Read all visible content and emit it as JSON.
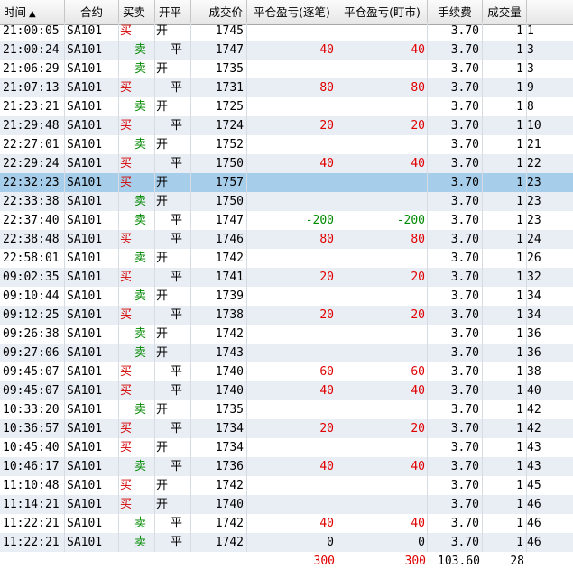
{
  "columns": {
    "time": "时间",
    "sort_glyph": "▲",
    "contract": "合约",
    "side": "买卖",
    "open_close": "开平",
    "price": "成交价",
    "pnl_trade": "平仓盈亏(逐笔)",
    "pnl_mark": "平仓盈亏(盯市)",
    "fee": "手续费",
    "volume": "成交量"
  },
  "labels": {
    "buy": "买",
    "sell": "卖",
    "open": "开",
    "close": "平"
  },
  "selected_row": 8,
  "rows": [
    {
      "time": "21:00:05",
      "contract": "SA101",
      "side": "buy",
      "oc": "open",
      "price": "1745",
      "pnl1": "",
      "pnl2": "",
      "fee": "3.70",
      "vol": "1",
      "extra": "1"
    },
    {
      "time": "21:00:24",
      "contract": "SA101",
      "side": "sell",
      "oc": "close",
      "price": "1747",
      "pnl1": "40",
      "pnl2": "40",
      "fee": "3.70",
      "vol": "1",
      "extra": "3"
    },
    {
      "time": "21:06:29",
      "contract": "SA101",
      "side": "sell",
      "oc": "open",
      "price": "1735",
      "pnl1": "",
      "pnl2": "",
      "fee": "3.70",
      "vol": "1",
      "extra": "3"
    },
    {
      "time": "21:07:13",
      "contract": "SA101",
      "side": "buy",
      "oc": "close",
      "price": "1731",
      "pnl1": "80",
      "pnl2": "80",
      "fee": "3.70",
      "vol": "1",
      "extra": "9"
    },
    {
      "time": "21:23:21",
      "contract": "SA101",
      "side": "sell",
      "oc": "open",
      "price": "1725",
      "pnl1": "",
      "pnl2": "",
      "fee": "3.70",
      "vol": "1",
      "extra": "8"
    },
    {
      "time": "21:29:48",
      "contract": "SA101",
      "side": "buy",
      "oc": "close",
      "price": "1724",
      "pnl1": "20",
      "pnl2": "20",
      "fee": "3.70",
      "vol": "1",
      "extra": "10"
    },
    {
      "time": "22:27:01",
      "contract": "SA101",
      "side": "sell",
      "oc": "open",
      "price": "1752",
      "pnl1": "",
      "pnl2": "",
      "fee": "3.70",
      "vol": "1",
      "extra": "21"
    },
    {
      "time": "22:29:24",
      "contract": "SA101",
      "side": "buy",
      "oc": "close",
      "price": "1750",
      "pnl1": "40",
      "pnl2": "40",
      "fee": "3.70",
      "vol": "1",
      "extra": "22"
    },
    {
      "time": "22:32:23",
      "contract": "SA101",
      "side": "buy",
      "oc": "open",
      "price": "1757",
      "pnl1": "",
      "pnl2": "",
      "fee": "3.70",
      "vol": "1",
      "extra": "23"
    },
    {
      "time": "22:33:38",
      "contract": "SA101",
      "side": "sell",
      "oc": "open",
      "price": "1750",
      "pnl1": "",
      "pnl2": "",
      "fee": "3.70",
      "vol": "1",
      "extra": "23"
    },
    {
      "time": "22:37:40",
      "contract": "SA101",
      "side": "sell",
      "oc": "close",
      "price": "1747",
      "pnl1": "-200",
      "pnl2": "-200",
      "fee": "3.70",
      "vol": "1",
      "extra": "23"
    },
    {
      "time": "22:38:48",
      "contract": "SA101",
      "side": "buy",
      "oc": "close",
      "price": "1746",
      "pnl1": "80",
      "pnl2": "80",
      "fee": "3.70",
      "vol": "1",
      "extra": "24"
    },
    {
      "time": "22:58:01",
      "contract": "SA101",
      "side": "sell",
      "oc": "open",
      "price": "1742",
      "pnl1": "",
      "pnl2": "",
      "fee": "3.70",
      "vol": "1",
      "extra": "26"
    },
    {
      "time": "09:02:35",
      "contract": "SA101",
      "side": "buy",
      "oc": "close",
      "price": "1741",
      "pnl1": "20",
      "pnl2": "20",
      "fee": "3.70",
      "vol": "1",
      "extra": "32"
    },
    {
      "time": "09:10:44",
      "contract": "SA101",
      "side": "sell",
      "oc": "open",
      "price": "1739",
      "pnl1": "",
      "pnl2": "",
      "fee": "3.70",
      "vol": "1",
      "extra": "34"
    },
    {
      "time": "09:12:25",
      "contract": "SA101",
      "side": "buy",
      "oc": "close",
      "price": "1738",
      "pnl1": "20",
      "pnl2": "20",
      "fee": "3.70",
      "vol": "1",
      "extra": "34"
    },
    {
      "time": "09:26:38",
      "contract": "SA101",
      "side": "sell",
      "oc": "open",
      "price": "1742",
      "pnl1": "",
      "pnl2": "",
      "fee": "3.70",
      "vol": "1",
      "extra": "36"
    },
    {
      "time": "09:27:06",
      "contract": "SA101",
      "side": "sell",
      "oc": "open",
      "price": "1743",
      "pnl1": "",
      "pnl2": "",
      "fee": "3.70",
      "vol": "1",
      "extra": "36"
    },
    {
      "time": "09:45:07",
      "contract": "SA101",
      "side": "buy",
      "oc": "close",
      "price": "1740",
      "pnl1": "60",
      "pnl2": "60",
      "fee": "3.70",
      "vol": "1",
      "extra": "38"
    },
    {
      "time": "09:45:07",
      "contract": "SA101",
      "side": "buy",
      "oc": "close",
      "price": "1740",
      "pnl1": "40",
      "pnl2": "40",
      "fee": "3.70",
      "vol": "1",
      "extra": "40"
    },
    {
      "time": "10:33:20",
      "contract": "SA101",
      "side": "sell",
      "oc": "open",
      "price": "1735",
      "pnl1": "",
      "pnl2": "",
      "fee": "3.70",
      "vol": "1",
      "extra": "42"
    },
    {
      "time": "10:36:57",
      "contract": "SA101",
      "side": "buy",
      "oc": "close",
      "price": "1734",
      "pnl1": "20",
      "pnl2": "20",
      "fee": "3.70",
      "vol": "1",
      "extra": "42"
    },
    {
      "time": "10:45:40",
      "contract": "SA101",
      "side": "buy",
      "oc": "open",
      "price": "1734",
      "pnl1": "",
      "pnl2": "",
      "fee": "3.70",
      "vol": "1",
      "extra": "43"
    },
    {
      "time": "10:46:17",
      "contract": "SA101",
      "side": "sell",
      "oc": "close",
      "price": "1736",
      "pnl1": "40",
      "pnl2": "40",
      "fee": "3.70",
      "vol": "1",
      "extra": "43"
    },
    {
      "time": "11:10:48",
      "contract": "SA101",
      "side": "buy",
      "oc": "open",
      "price": "1742",
      "pnl1": "",
      "pnl2": "",
      "fee": "3.70",
      "vol": "1",
      "extra": "45"
    },
    {
      "time": "11:14:21",
      "contract": "SA101",
      "side": "buy",
      "oc": "open",
      "price": "1740",
      "pnl1": "",
      "pnl2": "",
      "fee": "3.70",
      "vol": "1",
      "extra": "46"
    },
    {
      "time": "11:22:21",
      "contract": "SA101",
      "side": "sell",
      "oc": "close",
      "price": "1742",
      "pnl1": "40",
      "pnl2": "40",
      "fee": "3.70",
      "vol": "1",
      "extra": "46"
    },
    {
      "time": "11:22:21",
      "contract": "SA101",
      "side": "sell",
      "oc": "close",
      "price": "1742",
      "pnl1": "0",
      "pnl2": "0",
      "fee": "3.70",
      "vol": "1",
      "extra": "46"
    }
  ],
  "totals": {
    "pnl1": "300",
    "pnl2": "300",
    "fee": "103.60",
    "vol": "28"
  },
  "colors": {
    "buy": "#d40000",
    "sell": "#008a00",
    "selected": "#a6cde9",
    "alt_row": "#e9edf4"
  }
}
